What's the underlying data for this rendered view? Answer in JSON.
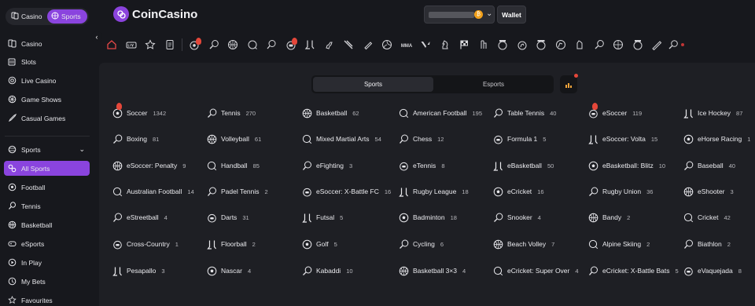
{
  "header": {
    "casino_label": "Casino",
    "sports_label": "Sports",
    "logo_text": "CoinCasino",
    "wallet_label": "Wallet",
    "coin_symbol": "₿"
  },
  "sidebar": {
    "items": [
      {
        "label": "Casino",
        "icon": "cards-icon"
      },
      {
        "label": "Slots",
        "icon": "slot-machine-icon"
      },
      {
        "label": "Live Casino",
        "icon": "roulette-icon"
      },
      {
        "label": "Game Shows",
        "icon": "wheel-icon"
      },
      {
        "label": "Casual Games",
        "icon": "rocket-icon"
      },
      {
        "label": "Sports",
        "icon": "sports-icon"
      },
      {
        "label": "All Sports",
        "icon": "all-sports-icon"
      },
      {
        "label": "Football",
        "icon": "football-icon"
      },
      {
        "label": "Tennis",
        "icon": "tennis-icon"
      },
      {
        "label": "Basketball",
        "icon": "basketball-icon"
      },
      {
        "label": "eSports",
        "icon": "controller-icon"
      },
      {
        "label": "In Play",
        "icon": "play-icon"
      },
      {
        "label": "My Bets",
        "icon": "bets-icon"
      },
      {
        "label": "Favourites",
        "icon": "star-icon"
      }
    ]
  },
  "tabs": {
    "sports": "Sports",
    "esports": "Esports"
  },
  "sports": [
    [
      {
        "name": "Soccer",
        "count": "1342",
        "live": true
      },
      {
        "name": "Boxing",
        "count": "81"
      },
      {
        "name": "eSoccer: Penalty",
        "count": "9"
      },
      {
        "name": "Australian Football",
        "count": "14"
      },
      {
        "name": "eStreetball",
        "count": "4"
      },
      {
        "name": "Cross-Country",
        "count": "1"
      },
      {
        "name": "Pesapallo",
        "count": "3"
      }
    ],
    [
      {
        "name": "Tennis",
        "count": "270"
      },
      {
        "name": "Volleyball",
        "count": "61"
      },
      {
        "name": "Handball",
        "count": "85"
      },
      {
        "name": "Padel Tennis",
        "count": "2"
      },
      {
        "name": "Darts",
        "count": "31"
      },
      {
        "name": "Floorball",
        "count": "2"
      },
      {
        "name": "Nascar",
        "count": "4"
      }
    ],
    [
      {
        "name": "Basketball",
        "count": "62"
      },
      {
        "name": "Mixed Martial Arts",
        "count": "54"
      },
      {
        "name": "eFighting",
        "count": "3"
      },
      {
        "name": "eSoccer: X-Battle FC",
        "count": "16"
      },
      {
        "name": "Futsal",
        "count": "5"
      },
      {
        "name": "Golf",
        "count": "5"
      },
      {
        "name": "Kabaddi",
        "count": "10"
      }
    ],
    [
      {
        "name": "American Football",
        "count": "195"
      },
      {
        "name": "Chess",
        "count": "12"
      },
      {
        "name": "eTennis",
        "count": "8"
      },
      {
        "name": "Rugby League",
        "count": "18"
      },
      {
        "name": "Badminton",
        "count": "18"
      },
      {
        "name": "Cycling",
        "count": "6"
      },
      {
        "name": "Basketball 3×3",
        "count": "4"
      }
    ],
    [
      {
        "name": "Table Tennis",
        "count": "40"
      },
      {
        "name": "Formula 1",
        "count": "5"
      },
      {
        "name": "eBasketball",
        "count": "50"
      },
      {
        "name": "eCricket",
        "count": "16"
      },
      {
        "name": "Snooker",
        "count": "4"
      },
      {
        "name": "Beach Volley",
        "count": "7"
      },
      {
        "name": "eCricket: Super Over",
        "count": "4"
      }
    ],
    [
      {
        "name": "eSoccer",
        "count": "119",
        "live": true
      },
      {
        "name": "eSoccer: Volta",
        "count": "15"
      },
      {
        "name": "eBasketball: Blitz",
        "count": "10"
      },
      {
        "name": "Rugby Union",
        "count": "36"
      },
      {
        "name": "Bandy",
        "count": "2"
      },
      {
        "name": "Alpine Skiing",
        "count": "2"
      },
      {
        "name": "eCricket: X-Battle Bats",
        "count": "5"
      }
    ],
    [
      {
        "name": "Ice Hockey",
        "count": "87"
      },
      {
        "name": "eHorse Racing",
        "count": "1"
      },
      {
        "name": "Baseball",
        "count": "40"
      },
      {
        "name": "eShooter",
        "count": "3"
      },
      {
        "name": "Cricket",
        "count": "42"
      },
      {
        "name": "Biathlon",
        "count": "2"
      },
      {
        "name": "eVaquejada",
        "count": "8"
      }
    ]
  ],
  "colors": {
    "accent": "#8a44de",
    "live": "#e5473a",
    "background": "#17181d",
    "panel": "#1e1f24"
  }
}
